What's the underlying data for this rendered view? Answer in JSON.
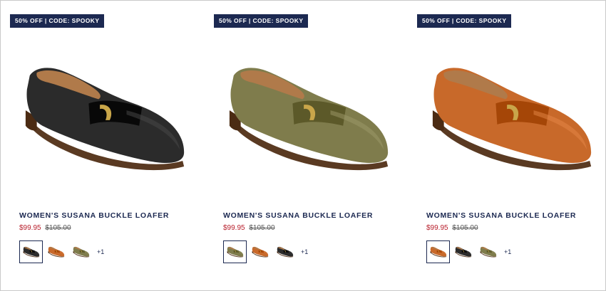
{
  "products": [
    {
      "badge": "50% OFF | CODE: SPOOKY",
      "title": "WOMEN'S SUSANA BUCKLE LOAFER",
      "sale_price": "$99.95",
      "original_price": "$105.00",
      "main_color": "#2b2b2b",
      "swatches": [
        {
          "color": "#2b2b2b",
          "selected": true
        },
        {
          "color": "#c8692a",
          "selected": false
        },
        {
          "color": "#7f7c4c",
          "selected": false
        }
      ],
      "more": "+1"
    },
    {
      "badge": "50% OFF | CODE: SPOOKY",
      "title": "WOMEN'S SUSANA BUCKLE LOAFER",
      "sale_price": "$99.95",
      "original_price": "$105.00",
      "main_color": "#7f7c4c",
      "swatches": [
        {
          "color": "#7f7c4c",
          "selected": true
        },
        {
          "color": "#c8692a",
          "selected": false
        },
        {
          "color": "#2b2b2b",
          "selected": false
        }
      ],
      "more": "+1"
    },
    {
      "badge": "50% OFF | CODE: SPOOKY",
      "title": "WOMEN'S SUSANA BUCKLE LOAFER",
      "sale_price": "$99.95",
      "original_price": "$105.00",
      "main_color": "#c8692a",
      "swatches": [
        {
          "color": "#c8692a",
          "selected": true
        },
        {
          "color": "#2b2b2b",
          "selected": false
        },
        {
          "color": "#7f7c4c",
          "selected": false
        }
      ],
      "more": "+1"
    }
  ],
  "colors": {
    "navy": "#1c2951",
    "sale": "#b8202d",
    "sole": "#5a3a22"
  },
  "icons": {
    "product_image": "loafer-shoe-icon"
  }
}
